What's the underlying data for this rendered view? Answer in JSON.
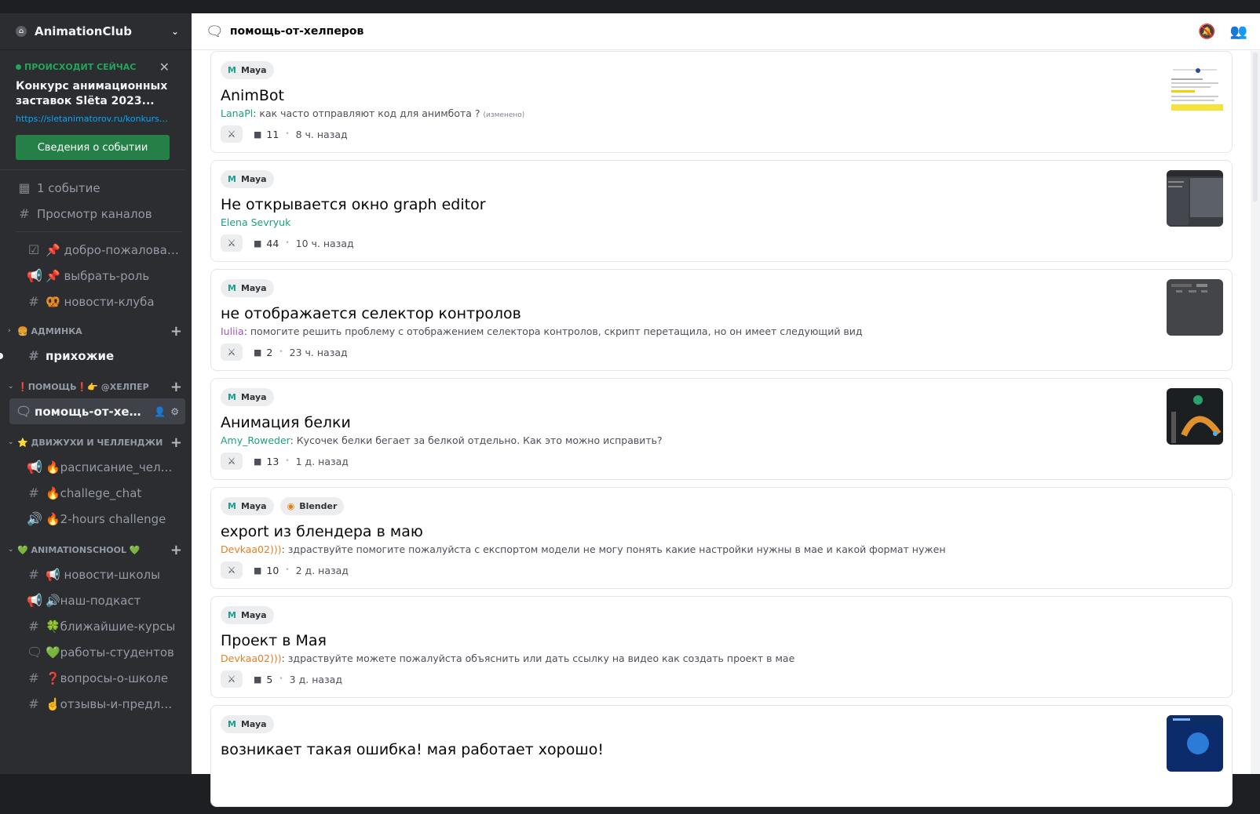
{
  "server": {
    "name": "AnimationClub"
  },
  "event": {
    "live_label": "ПРОИСХОДИТ СЕЙЧАС",
    "title": "Конкурс анимационных заставок Slёta 2023...",
    "link": "https://sletanimatorov.ru/konkurs?ut...",
    "button": "Сведения о событии"
  },
  "nav": {
    "events": "1 событие",
    "browse": "Просмотр каналов"
  },
  "channels_top": [
    {
      "name": "📌 добро-пожаловать",
      "icon": "rules-icon"
    },
    {
      "name": "📌 выбрать-роль",
      "icon": "announcement-icon"
    },
    {
      "name": "🥨 новости-клуба",
      "icon": "hash-icon"
    }
  ],
  "categories": {
    "admin": "🍔 АДМИНКА",
    "help": "❗ПОМОЩЬ❗👉 @ХЕЛПЕР",
    "events": "⭐ ДВИЖУХИ И ЧЕЛЛЕНДЖИ",
    "school": "💚 ANIMATIONSCHOOL 💚"
  },
  "channel_hallway": "прихожие",
  "channel_help": "помощь-от-хелпе...",
  "events_channels": [
    {
      "name": "🔥расписание_челленжа",
      "icon": "announcement-icon"
    },
    {
      "name": "🔥challege_chat",
      "icon": "hash-icon"
    },
    {
      "name": "🔥2-hours challenge",
      "icon": "speaker-icon"
    }
  ],
  "school_channels": [
    {
      "name": "📢 новости-школы",
      "icon": "hash-icon"
    },
    {
      "name": "🔊наш-подкаст",
      "icon": "announcement-icon"
    },
    {
      "name": "🍀ближайшие-курсы",
      "icon": "hash-icon"
    },
    {
      "name": "💚работы-студентов",
      "icon": "forum-icon"
    },
    {
      "name": "❓вопросы-о-школе",
      "icon": "hash-icon"
    },
    {
      "name": "☝️отзывы-и-предложе...",
      "icon": "hash-icon"
    }
  ],
  "header": {
    "title": "помощь-от-хелперов"
  },
  "posts": [
    {
      "tags": [
        "Maya"
      ],
      "title": "AnimBot",
      "author": "LanaPl",
      "author_color": "#1a9e83",
      "preview": ": как часто отправляют код для анимбота ? ",
      "edited": "(изменено)",
      "count": "11",
      "time": "8 ч. назад",
      "thumb": "doc"
    },
    {
      "tags": [
        "Maya"
      ],
      "title": "Не открывается окно graph editor",
      "author": "Elena Sevryuk",
      "author_color": "#1a9e83",
      "preview": "",
      "edited": "",
      "count": "44",
      "time": "10 ч. назад",
      "thumb": "editor"
    },
    {
      "tags": [
        "Maya"
      ],
      "title": "не отображается селектор контролов",
      "author": "Iuliia",
      "author_color": "#9b59b6",
      "preview": ": помогите решить проблему с отображением селектора контролов, скрипт перетащила, но он имеет следующий вид",
      "edited": "",
      "count": "2",
      "time": "23 ч. назад",
      "thumb": "dark"
    },
    {
      "tags": [
        "Maya"
      ],
      "title": "Анимация белки",
      "author": "Amy_Roweder",
      "author_color": "#1a9e83",
      "preview": ": Кусочек белки бегает за белкой отдельно. Как это можно исправить?",
      "edited": "",
      "count": "13",
      "time": "1 д. назад",
      "thumb": "squirrel"
    },
    {
      "tags": [
        "Maya",
        "Blender"
      ],
      "title": "export из блендера в маю",
      "author": "Devkaa02)))",
      "author_color": "#e67e22",
      "preview": ": здраствуйте помогите пожалуйста с експортом модели не могу понять какие настройки нужны в мае и какой формат нужен",
      "edited": "",
      "count": "10",
      "time": "2 д. назад",
      "thumb": ""
    },
    {
      "tags": [
        "Maya"
      ],
      "title": "Проект в Мая",
      "author": "Devkaa02)))",
      "author_color": "#e67e22",
      "preview": ": здраствуйте можете пожалуйста объяснить или дать ссылку на видео как создать проект в мае",
      "edited": "",
      "count": "5",
      "time": "3 д. назад",
      "thumb": ""
    },
    {
      "tags": [
        "Maya"
      ],
      "title": "возникает такая ошибка! мая работает хорошо!",
      "author": "",
      "author_color": "#1a9e83",
      "preview": "",
      "edited": "",
      "count": "",
      "time": "",
      "thumb": "blue"
    }
  ]
}
